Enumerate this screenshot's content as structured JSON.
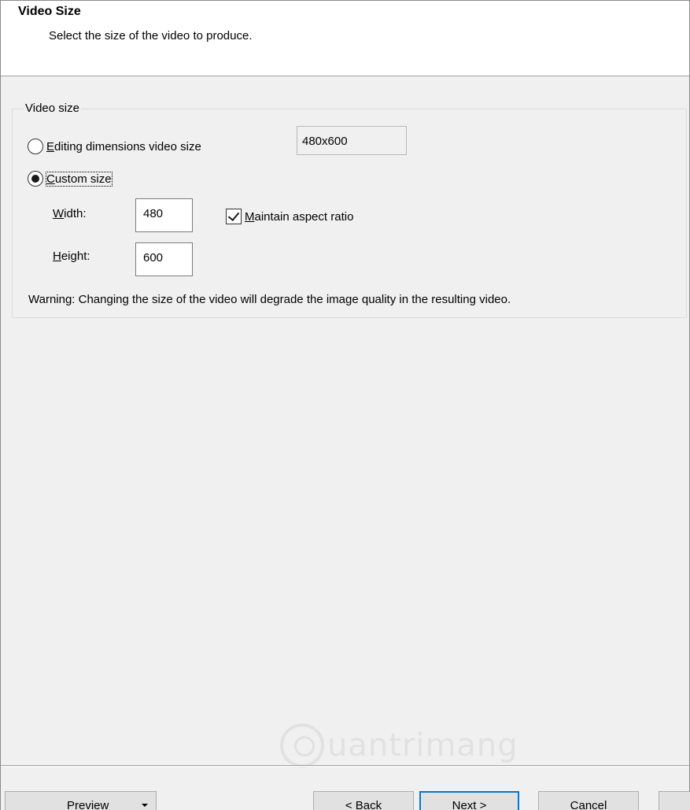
{
  "header": {
    "title": "Video Size",
    "subtitle": "Select the size of the video to produce."
  },
  "group": {
    "legend": "Video size",
    "option_editing": {
      "label_accel": "E",
      "label_rest": "diting dimensions video size",
      "selected": false
    },
    "editing_value": "480x600",
    "option_custom": {
      "label_accel": "C",
      "label_rest": "ustom size",
      "selected": true
    },
    "width": {
      "label_accel": "W",
      "label_rest": "idth:",
      "value": "480"
    },
    "height": {
      "label_accel": "H",
      "label_rest": "eight:",
      "value": "600"
    },
    "maintain_aspect": {
      "label_accel": "M",
      "label_rest": "aintain aspect ratio",
      "checked": true
    },
    "warning": "Warning: Changing the size of the video will degrade the image quality in the resulting video."
  },
  "footer": {
    "preview": {
      "before": "Pre",
      "accel": "v",
      "after": "iew"
    },
    "back": {
      "before": "< ",
      "accel": "B",
      "after": "ack"
    },
    "next": {
      "before": "",
      "accel": "N",
      "after": "ext >"
    },
    "cancel": "Cancel"
  },
  "watermark": "uantrimang"
}
